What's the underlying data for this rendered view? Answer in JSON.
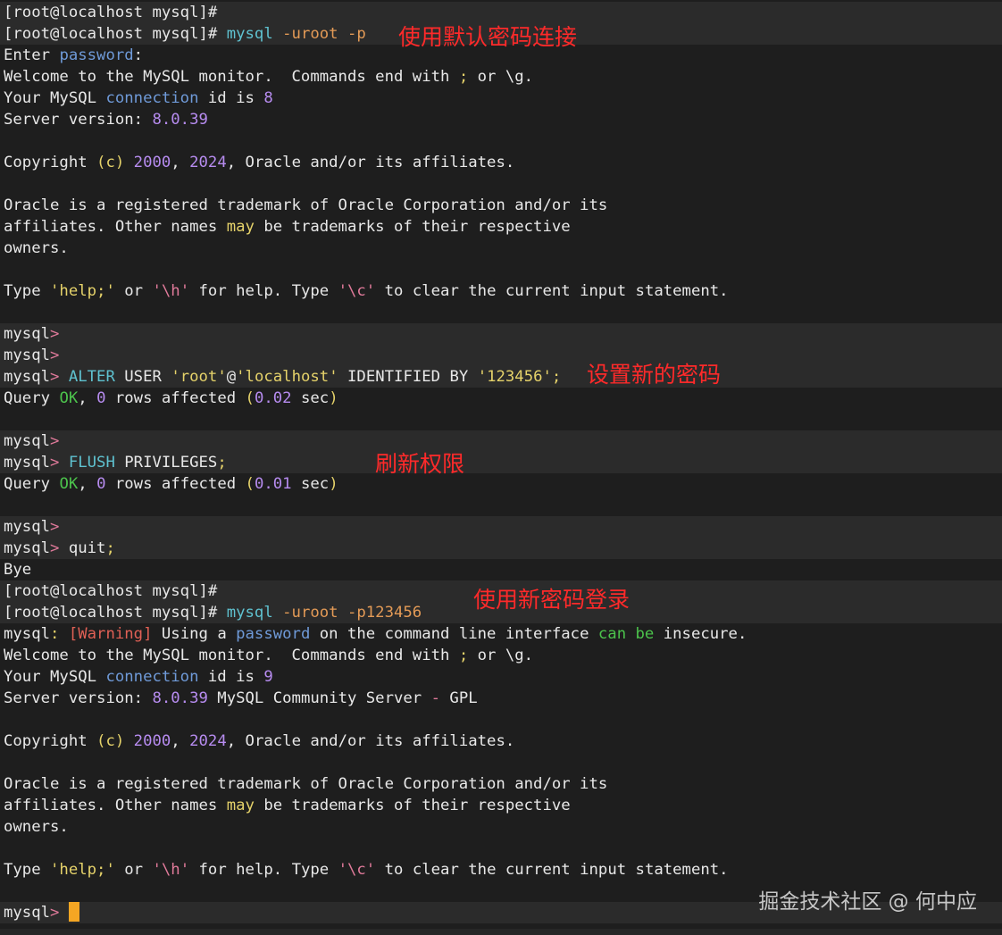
{
  "terminal": {
    "lines": [
      {
        "hl": true,
        "segs": [
          [
            "[root@localhost mysql]# ",
            "def"
          ]
        ]
      },
      {
        "hl": true,
        "segs": [
          [
            "[root@localhost mysql]# ",
            "def"
          ],
          [
            "mysql ",
            "teal"
          ],
          [
            "-uroot -p",
            "orange"
          ]
        ]
      },
      {
        "hl": false,
        "segs": [
          [
            "Enter ",
            "def"
          ],
          [
            "password",
            "blue"
          ],
          [
            ":",
            "def"
          ]
        ]
      },
      {
        "hl": false,
        "segs": [
          [
            "Welcome to the MySQL monitor.  Commands end with ",
            "def"
          ],
          [
            ";",
            "yellow"
          ],
          [
            " or \\g.",
            "def"
          ]
        ]
      },
      {
        "hl": false,
        "segs": [
          [
            "Your MySQL ",
            "def"
          ],
          [
            "connection",
            "blue"
          ],
          [
            " id is ",
            "def"
          ],
          [
            "8",
            "purple"
          ]
        ]
      },
      {
        "hl": false,
        "segs": [
          [
            "Server version: ",
            "def"
          ],
          [
            "8.0.39",
            "purple"
          ]
        ]
      },
      {
        "hl": false,
        "segs": [
          [
            "",
            "def"
          ]
        ]
      },
      {
        "hl": false,
        "segs": [
          [
            "Copyright ",
            "def"
          ],
          [
            "(c)",
            "yellow"
          ],
          [
            " ",
            "def"
          ],
          [
            "2000",
            "purple"
          ],
          [
            ", ",
            "def"
          ],
          [
            "2024",
            "purple"
          ],
          [
            ", Oracle and/or its affiliates.",
            "def"
          ]
        ]
      },
      {
        "hl": false,
        "segs": [
          [
            "",
            "def"
          ]
        ]
      },
      {
        "hl": false,
        "segs": [
          [
            "Oracle is a registered trademark of Oracle Corporation and/or its",
            "def"
          ]
        ]
      },
      {
        "hl": false,
        "segs": [
          [
            "affiliates. Other names ",
            "def"
          ],
          [
            "may",
            "yellow"
          ],
          [
            " be trademarks of their respective",
            "def"
          ]
        ]
      },
      {
        "hl": false,
        "segs": [
          [
            "owners.",
            "def"
          ]
        ]
      },
      {
        "hl": false,
        "segs": [
          [
            "",
            "def"
          ]
        ]
      },
      {
        "hl": false,
        "segs": [
          [
            "Type ",
            "def"
          ],
          [
            "'help;'",
            "yellow"
          ],
          [
            " or ",
            "def"
          ],
          [
            "'\\h'",
            "pink"
          ],
          [
            " for help. Type ",
            "def"
          ],
          [
            "'\\c'",
            "pink"
          ],
          [
            " to clear the current input statement.",
            "def"
          ]
        ]
      },
      {
        "hl": false,
        "segs": [
          [
            "",
            "def"
          ]
        ]
      },
      {
        "hl": true,
        "segs": [
          [
            "mysql",
            "def"
          ],
          [
            "> ",
            "pink"
          ]
        ]
      },
      {
        "hl": true,
        "segs": [
          [
            "mysql",
            "def"
          ],
          [
            "> ",
            "pink"
          ]
        ]
      },
      {
        "hl": true,
        "segs": [
          [
            "mysql",
            "def"
          ],
          [
            "> ",
            "pink"
          ],
          [
            "ALTER",
            "teal"
          ],
          [
            " USER ",
            "def"
          ],
          [
            "'root'",
            "yellow"
          ],
          [
            "@",
            "def"
          ],
          [
            "'localhost'",
            "yellow"
          ],
          [
            " IDENTIFIED BY ",
            "def"
          ],
          [
            "'123456'",
            "yellow"
          ],
          [
            ";",
            "yellow"
          ]
        ]
      },
      {
        "hl": false,
        "segs": [
          [
            "Query ",
            "def"
          ],
          [
            "OK",
            "green"
          ],
          [
            ", ",
            "def"
          ],
          [
            "0",
            "purple"
          ],
          [
            " rows affected ",
            "def"
          ],
          [
            "(",
            "yellow"
          ],
          [
            "0.02",
            "purple"
          ],
          [
            " sec",
            "def"
          ],
          [
            ")",
            "yellow"
          ]
        ]
      },
      {
        "hl": false,
        "segs": [
          [
            "",
            "def"
          ]
        ]
      },
      {
        "hl": true,
        "segs": [
          [
            "mysql",
            "def"
          ],
          [
            "> ",
            "pink"
          ]
        ]
      },
      {
        "hl": true,
        "segs": [
          [
            "mysql",
            "def"
          ],
          [
            "> ",
            "pink"
          ],
          [
            "FLUSH",
            "teal"
          ],
          [
            " PRIVILEGES",
            "def"
          ],
          [
            ";",
            "yellow"
          ]
        ]
      },
      {
        "hl": false,
        "segs": [
          [
            "Query ",
            "def"
          ],
          [
            "OK",
            "green"
          ],
          [
            ", ",
            "def"
          ],
          [
            "0",
            "purple"
          ],
          [
            " rows affected ",
            "def"
          ],
          [
            "(",
            "yellow"
          ],
          [
            "0.01",
            "purple"
          ],
          [
            " sec",
            "def"
          ],
          [
            ")",
            "yellow"
          ]
        ]
      },
      {
        "hl": false,
        "segs": [
          [
            "",
            "def"
          ]
        ]
      },
      {
        "hl": true,
        "segs": [
          [
            "mysql",
            "def"
          ],
          [
            "> ",
            "pink"
          ]
        ]
      },
      {
        "hl": true,
        "segs": [
          [
            "mysql",
            "def"
          ],
          [
            "> ",
            "pink"
          ],
          [
            "quit",
            "def"
          ],
          [
            ";",
            "yellow"
          ]
        ]
      },
      {
        "hl": false,
        "segs": [
          [
            "Bye",
            "def"
          ]
        ]
      },
      {
        "hl": true,
        "segs": [
          [
            "[root@localhost mysql]# ",
            "def"
          ]
        ]
      },
      {
        "hl": true,
        "segs": [
          [
            "[root@localhost mysql]# ",
            "def"
          ],
          [
            "mysql ",
            "teal"
          ],
          [
            "-uroot -p123456",
            "orange"
          ]
        ]
      },
      {
        "hl": false,
        "segs": [
          [
            "mysql",
            "def"
          ],
          [
            ": ",
            "yellow"
          ],
          [
            "[Warning]",
            "red"
          ],
          [
            " Using a ",
            "def"
          ],
          [
            "password",
            "blue"
          ],
          [
            " on the command line interface ",
            "def"
          ],
          [
            "can",
            "green"
          ],
          [
            " ",
            "def"
          ],
          [
            "be",
            "green"
          ],
          [
            " insecure.",
            "def"
          ]
        ]
      },
      {
        "hl": false,
        "segs": [
          [
            "Welcome to the MySQL monitor.  Commands end with ",
            "def"
          ],
          [
            ";",
            "yellow"
          ],
          [
            " or \\g.",
            "def"
          ]
        ]
      },
      {
        "hl": false,
        "segs": [
          [
            "Your MySQL ",
            "def"
          ],
          [
            "connection",
            "blue"
          ],
          [
            " id is ",
            "def"
          ],
          [
            "9",
            "purple"
          ]
        ]
      },
      {
        "hl": false,
        "segs": [
          [
            "Server version: ",
            "def"
          ],
          [
            "8.0.39",
            "purple"
          ],
          [
            " MySQL Community Server ",
            "def"
          ],
          [
            "-",
            "pink"
          ],
          [
            " GPL",
            "def"
          ]
        ]
      },
      {
        "hl": false,
        "segs": [
          [
            "",
            "def"
          ]
        ]
      },
      {
        "hl": false,
        "segs": [
          [
            "Copyright ",
            "def"
          ],
          [
            "(c)",
            "yellow"
          ],
          [
            " ",
            "def"
          ],
          [
            "2000",
            "purple"
          ],
          [
            ", ",
            "def"
          ],
          [
            "2024",
            "purple"
          ],
          [
            ", Oracle and/or its affiliates.",
            "def"
          ]
        ]
      },
      {
        "hl": false,
        "segs": [
          [
            "",
            "def"
          ]
        ]
      },
      {
        "hl": false,
        "segs": [
          [
            "Oracle is a registered trademark of Oracle Corporation and/or its",
            "def"
          ]
        ]
      },
      {
        "hl": false,
        "segs": [
          [
            "affiliates. Other names ",
            "def"
          ],
          [
            "may",
            "yellow"
          ],
          [
            " be trademarks of their respective",
            "def"
          ]
        ]
      },
      {
        "hl": false,
        "segs": [
          [
            "owners.",
            "def"
          ]
        ]
      },
      {
        "hl": false,
        "segs": [
          [
            "",
            "def"
          ]
        ]
      },
      {
        "hl": false,
        "segs": [
          [
            "Type ",
            "def"
          ],
          [
            "'help;'",
            "yellow"
          ],
          [
            " or ",
            "def"
          ],
          [
            "'\\h'",
            "pink"
          ],
          [
            " for help. Type ",
            "def"
          ],
          [
            "'\\c'",
            "pink"
          ],
          [
            " to clear the current input statement.",
            "def"
          ]
        ]
      },
      {
        "hl": false,
        "segs": [
          [
            "",
            "def"
          ]
        ]
      },
      {
        "hl": true,
        "cursor": true,
        "segs": [
          [
            "mysql",
            "def"
          ],
          [
            "> ",
            "pink"
          ]
        ]
      }
    ]
  },
  "annotations": {
    "connect_default": "使用默认密码连接",
    "set_new_password": "设置新的密码",
    "flush_privileges": "刷新权限",
    "login_new_password": "使用新密码登录"
  },
  "watermark": "掘金技术社区 @ 何中应",
  "colors": {
    "background": "#1e1e1e",
    "highlight_row": "#2b2b2b",
    "annotation": "#ff2a2a",
    "cursor": "#f5a623"
  }
}
